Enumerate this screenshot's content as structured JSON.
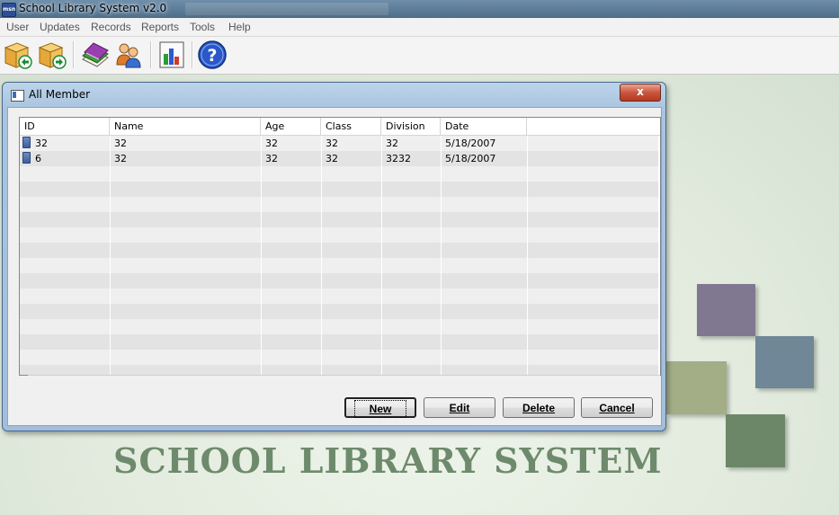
{
  "app": {
    "title": "School Library System v2.0",
    "icon_label": "msn"
  },
  "menu": [
    "User",
    "Updates",
    "Records",
    "Reports",
    "Tools",
    "Help"
  ],
  "toolbar": [
    {
      "name": "issue-book-icon"
    },
    {
      "name": "return-book-icon"
    },
    {
      "name": "books-icon"
    },
    {
      "name": "members-icon"
    },
    {
      "name": "report-chart-icon"
    },
    {
      "name": "help-icon"
    }
  ],
  "dialog": {
    "title": "All Member",
    "close": "x",
    "columns": [
      "ID",
      "Name",
      "Age",
      "Class",
      "Division",
      "Date"
    ],
    "rows": [
      [
        "32",
        "32",
        "32",
        "32",
        "32",
        "5/18/2007"
      ],
      [
        "6",
        "32",
        "32",
        "32",
        "3232",
        "5/18/2007"
      ]
    ],
    "buttons": {
      "new": "New",
      "edit": "Edit",
      "delete": "Delete",
      "cancel": "Cancel"
    }
  },
  "banner": "SCHOOL LIBRARY  SYSTEM",
  "colors": {
    "title_bar": "#5b7a96",
    "close_button": "#c9553d",
    "banner_text": "#6e8a6c",
    "square_purple": "#7f7890",
    "square_blue": "#6f8796",
    "square_olive": "#a3ad86",
    "square_green": "#6b8767"
  }
}
